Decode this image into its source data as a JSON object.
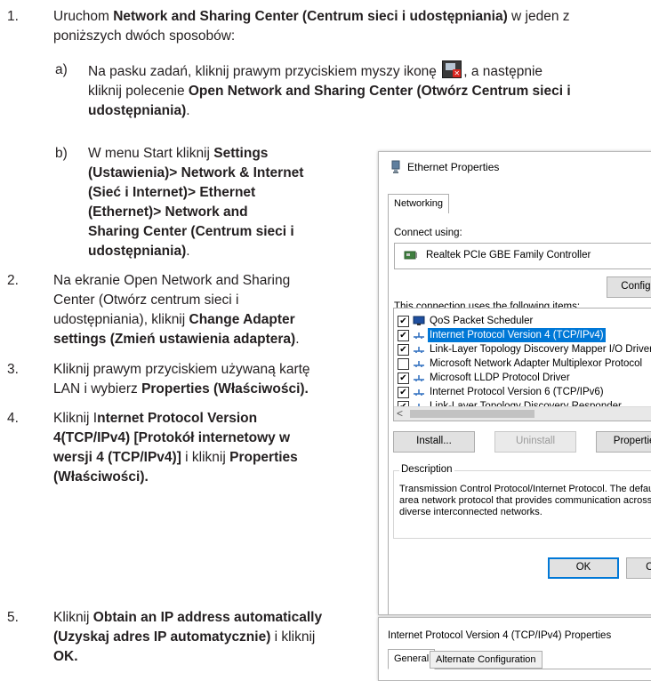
{
  "steps": {
    "s1": {
      "num": "1.",
      "prefix": "Uruchom ",
      "bold": "Network and Sharing Center (Centrum sieci i udostępniania)",
      "suffix1": " w jeden z",
      "line2": "poniższych dwóch sposobów:"
    },
    "s1a": {
      "letter": "a)",
      "line1": "Na pasku zadań, kliknij prawym przyciskiem myszy ikonę",
      "line1b": ", a następnie",
      "line2a": "kliknij polecenie ",
      "line2b": "Open Network and Sharing Center (Otwórz Centrum sieci i",
      "line3": "udostępniania)",
      "line3end": "."
    },
    "s1b": {
      "letter": "b)",
      "line1a": "W menu Start kliknij ",
      "line1b": "Settings",
      "line2": "(Ustawienia)> Network & Internet",
      "line3": "(Sieć i Internet)> Ethernet",
      "line4": "(Ethernet)> Network and",
      "line5": "Sharing Center (Centrum sieci i",
      "line6": "udostępniania)",
      "line6end": "."
    },
    "s2": {
      "num": "2.",
      "line1": "Na ekranie Open Network and Sharing",
      "line2": "Center (Otwórz centrum sieci i",
      "line3a": "udostępniania), kliknij ",
      "line3b": "Change Adapter",
      "line4": "settings (Zmień ustawienia adaptera)",
      "line4end": "."
    },
    "s3": {
      "num": "3.",
      "line1": "Kliknij prawym przyciskiem używaną kartę",
      "line2a": "LAN i wybierz ",
      "line2b": "Properties (Właściwości)."
    },
    "s4": {
      "num": "4.",
      "line1a": "Kliknij I",
      "line1b": "nternet Protocol Version",
      "line2": "4(TCP/IPv4) [Protokół internetowy w",
      "line3a": "wersji 4 (TCP/IPv4)]",
      "line3b": " i kliknij ",
      "line3c": "Properties",
      "line4": "(Właściwości)."
    },
    "s5": {
      "num": "5.",
      "line1a": "Kliknij ",
      "line1b": "Obtain an IP address automatically",
      "line2a": "(Uzyskaj adres IP automatycznie)",
      "line2b": " i kliknij",
      "line3": "OK."
    }
  },
  "ethernet_dialog": {
    "title": "Ethernet Properties",
    "tab": "Networking",
    "connect_using_label": "Connect using:",
    "adapter": "Realtek PCIe GBE Family Controller",
    "configure_button": "Configure...",
    "items_label": "This connection uses the following items:",
    "items": [
      {
        "label": "QoS Packet Scheduler",
        "checked": true,
        "selected": false
      },
      {
        "label": "Internet Protocol Version 4 (TCP/IPv4)",
        "checked": true,
        "selected": true
      },
      {
        "label": "Link-Layer Topology Discovery Mapper I/O Driver",
        "checked": true,
        "selected": false
      },
      {
        "label": "Microsoft Network Adapter Multiplexor Protocol",
        "checked": false,
        "selected": false
      },
      {
        "label": "Microsoft LLDP Protocol Driver",
        "checked": true,
        "selected": false
      },
      {
        "label": "Internet Protocol Version 6 (TCP/IPv6)",
        "checked": true,
        "selected": false
      },
      {
        "label": "Link-Layer Topology Discovery Responder",
        "checked": true,
        "selected": false
      }
    ],
    "scroll_left_arrow": "<",
    "install_button": "Install...",
    "uninstall_button": "Uninstall",
    "properties_button": "Properties",
    "description_legend": "Description",
    "description_text": "Transmission Control Protocol/Internet Protocol. The default wide area network protocol that provides communication across diverse interconnected networks.",
    "ok_button": "OK",
    "cancel_button": "Cancel"
  },
  "ipv4_dialog": {
    "title": "Internet Protocol Version 4 (TCP/IPv4) Properties",
    "tab_general": "General",
    "tab_alternate": "Alternate Configuration"
  },
  "colors": {
    "text": "#231f20",
    "selection": "#0078d7",
    "tray_icon_badge": "#d8261f"
  }
}
